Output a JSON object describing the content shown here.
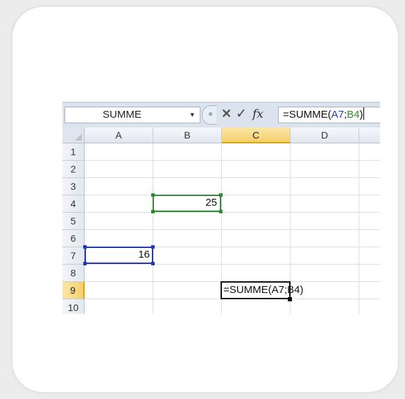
{
  "formula_bar": {
    "name_box": "SUMME",
    "dropdown_arrow": "▾",
    "cancel_icon": "✕",
    "enter_icon": "✓",
    "fx_label": "fx",
    "formula_prefix": "=SUMME(",
    "formula_ref_a": "A7",
    "formula_sep": ";",
    "formula_ref_b": "B4",
    "formula_suffix": ")"
  },
  "columns": [
    "A",
    "B",
    "C",
    "D"
  ],
  "selected_column": "C",
  "rows": [
    "1",
    "2",
    "3",
    "4",
    "5",
    "6",
    "7",
    "8",
    "9",
    "10"
  ],
  "selected_row": "9",
  "cells": {
    "B4": "25",
    "A7": "16",
    "C9": "=SUMME(A7;B4)"
  },
  "colors": {
    "ref_a": "#2339b0",
    "ref_b": "#2f8b2f",
    "header_selected": "#f6cf6b"
  }
}
